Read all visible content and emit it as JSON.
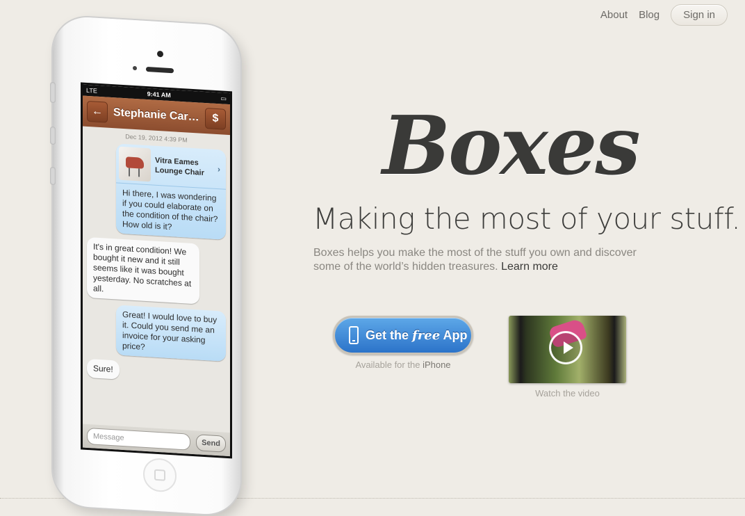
{
  "nav": {
    "about": "About",
    "blog": "Blog",
    "signin": "Sign in"
  },
  "phone": {
    "status": {
      "carrier": "LTE",
      "time": "9:41 AM"
    },
    "conversation": {
      "contact": "Stephanie Carpen...",
      "back_icon": "arrow-left-icon",
      "pay_label": "$",
      "date": "Dec 19, 2012 4:39 PM",
      "item": {
        "name": "Vitra Eames Lounge Chair",
        "chevron": "›"
      },
      "messages": [
        {
          "from": "me",
          "text": "Hi there, I was wondering if you could elaborate on the condition of the chair? How old is it?"
        },
        {
          "from": "them",
          "text": "It's in great condition! We bought it new and it still seems like it was bought yesterday. No scratches at all."
        },
        {
          "from": "me",
          "text": "Great! I would love to buy it. Could you send me an invoice for your asking price?"
        },
        {
          "from": "them",
          "text": "Sure!"
        }
      ],
      "input_placeholder": "Message",
      "send_label": "Send"
    }
  },
  "hero": {
    "logo": "Boxes",
    "tagline": "Making the most of your stuff.",
    "description": "Boxes helps you make the most of the stuff you own and discover some of the world’s hidden treasures.",
    "learn_more": "Learn more"
  },
  "cta": {
    "label_pre": "Get the",
    "label_free": "free",
    "label_post": "App",
    "available_pre": "Available for the",
    "available_platform": "iPhone"
  },
  "video": {
    "caption": "Watch the video"
  },
  "colors": {
    "background": "#efece6",
    "accent": "#2c73c9",
    "navbar": "#9a5535"
  }
}
